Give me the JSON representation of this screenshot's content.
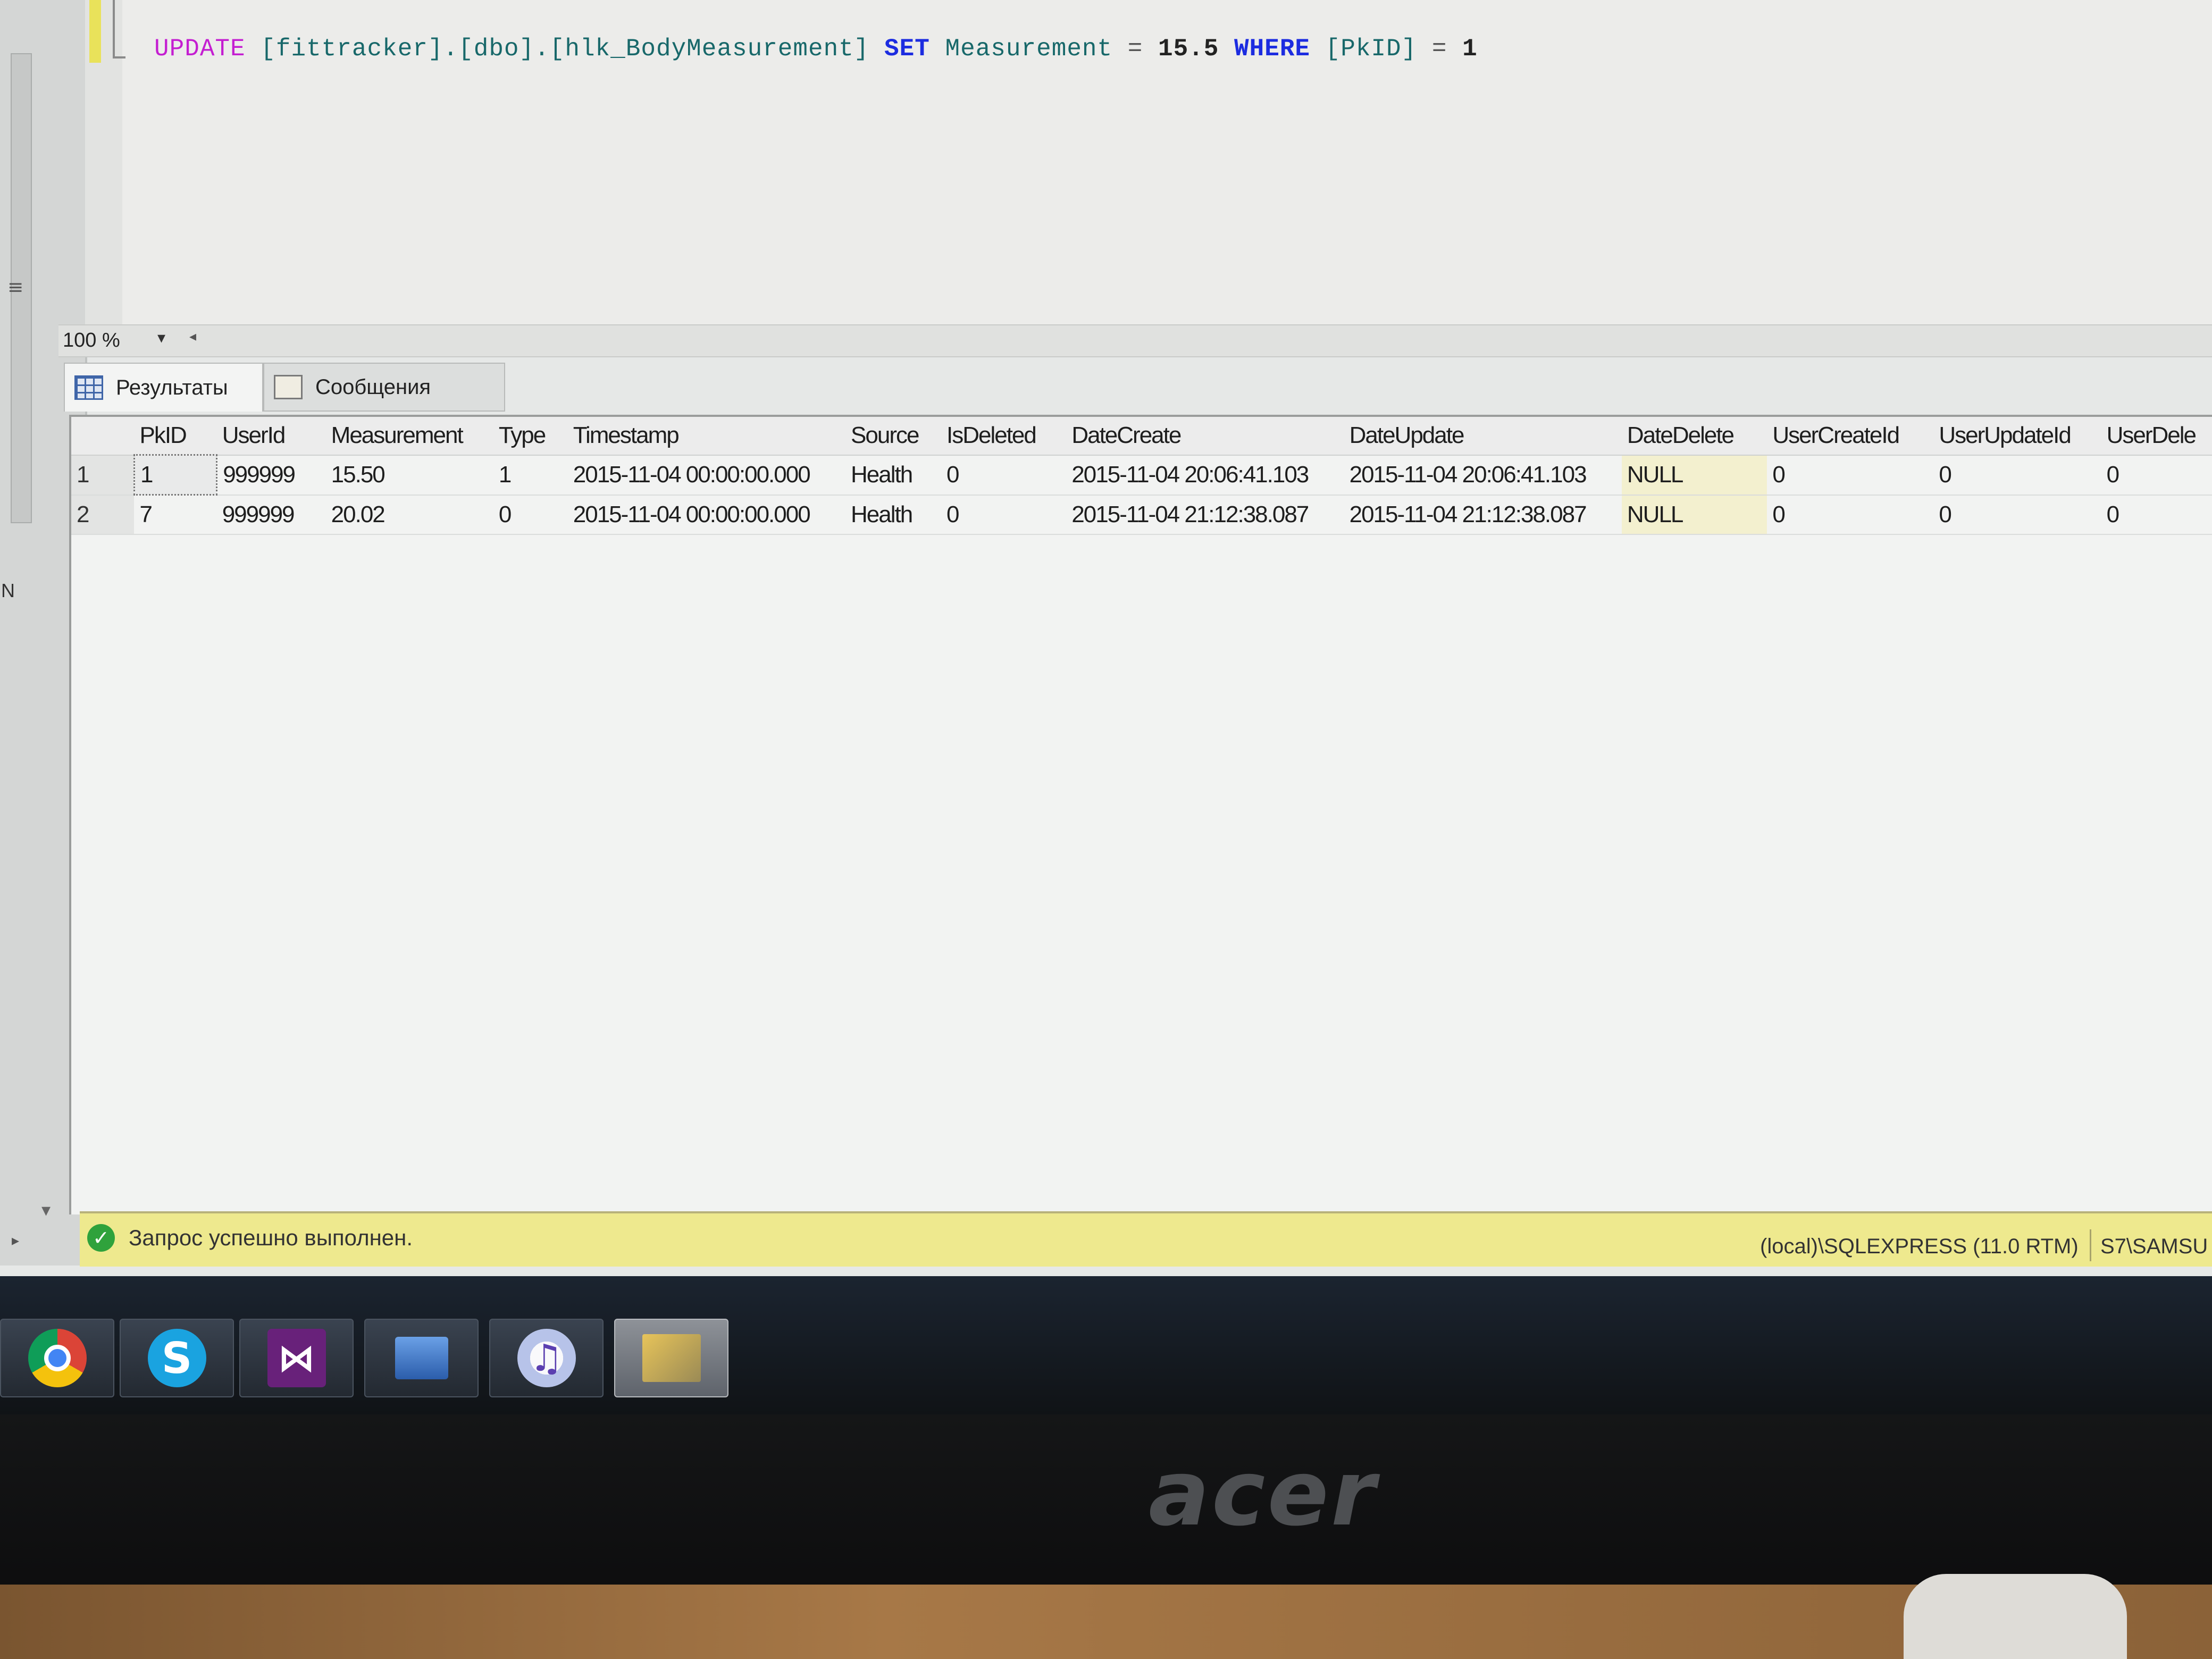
{
  "editor": {
    "kw_update": "UPDATE",
    "object": "[fittracker].[dbo].[hlk_BodyMeasurement]",
    "kw_set": "SET",
    "column": "Measurement",
    "eq1": "=",
    "value": "15.5",
    "kw_where": "WHERE",
    "key": "[PkID]",
    "eq2": "=",
    "key_value": "1"
  },
  "zoom": {
    "value": "100 %"
  },
  "tabs": [
    {
      "label": "Результаты",
      "icon": "grid-icon"
    },
    {
      "label": "Сообщения",
      "icon": "messages-icon"
    }
  ],
  "results": {
    "columns": [
      "PkID",
      "UserId",
      "Measurement",
      "Type",
      "Timestamp",
      "Source",
      "IsDeleted",
      "DateCreate",
      "DateUpdate",
      "DateDelete",
      "UserCreateId",
      "UserUpdateId",
      "UserDele"
    ],
    "rows": [
      {
        "num": "1",
        "cells": [
          "1",
          "999999",
          "15.50",
          "1",
          "2015-11-04 00:00:00.000",
          "Health",
          "0",
          "2015-11-04 20:06:41.103",
          "2015-11-04 20:06:41.103",
          "NULL",
          "0",
          "0",
          "0"
        ]
      },
      {
        "num": "2",
        "cells": [
          "7",
          "999999",
          "20.02",
          "0",
          "2015-11-04 00:00:00.000",
          "Health",
          "0",
          "2015-11-04 21:12:38.087",
          "2015-11-04 21:12:38.087",
          "NULL",
          "0",
          "0",
          "0"
        ]
      }
    ]
  },
  "status": {
    "message": "Запрос успешно выполнен.",
    "server": "(local)\\SQLEXPRESS (11.0 RTM)",
    "user": "S7\\SAMSU",
    "ok_color": "#2fa23c",
    "bar_color": "#eee98e"
  },
  "taskbar": {
    "apps": [
      "chrome-icon",
      "skype-icon",
      "visual-studio-icon",
      "remote-desktop-icon",
      "itunes-icon",
      "sql-management-studio-icon"
    ],
    "skype_glyph": "S",
    "vs_glyph": "⋈",
    "itunes_glyph": "♫"
  },
  "monitor": {
    "brand": "acer"
  }
}
